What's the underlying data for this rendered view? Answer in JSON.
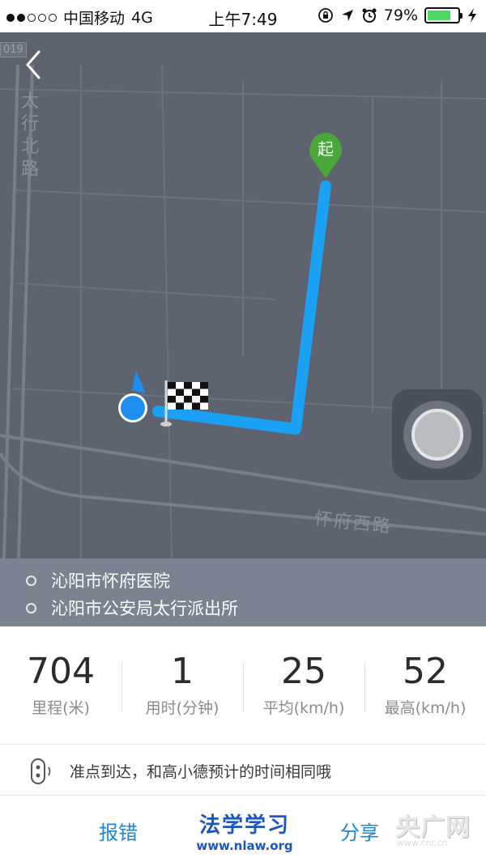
{
  "status_bar": {
    "signal_dots_filled": 2,
    "signal_dots_total": 5,
    "carrier": "中国移动",
    "network": "4G",
    "time": "上午7:49",
    "battery": "79%",
    "battery_level": 0.79,
    "icons": [
      "orientation-lock-icon",
      "location-arrow-icon",
      "alarm-icon",
      "charging-icon"
    ]
  },
  "map": {
    "road_number": "019",
    "road_vertical": "太行北路",
    "road_horizontal": "怀府西路",
    "start_marker": "起",
    "colors": {
      "route": "#1aa1f5",
      "start_marker": "#4aa83b",
      "map_bg": "#5d6470",
      "position_dot": "#1e8ff0"
    }
  },
  "addresses": {
    "start": "沁阳市怀府医院",
    "end": "沁阳市公安局太行派出所"
  },
  "stats": [
    {
      "value": "704",
      "label": "里程(米)"
    },
    {
      "value": "1",
      "label": "用时(分钟)"
    },
    {
      "value": "25",
      "label": "平均(km/h)"
    },
    {
      "value": "52",
      "label": "最高(km/h)"
    }
  ],
  "message": {
    "text": "准点到达，和高小德预计的时间相同哦",
    "icon": "voice-assistant-icon"
  },
  "actions": {
    "report": "报错",
    "share": "分享"
  },
  "watermarks": {
    "law_title": "法学学习",
    "law_url": "www.nlaw.org",
    "cnr": "央广网",
    "cnr_sub": "www.cnr.cn"
  }
}
